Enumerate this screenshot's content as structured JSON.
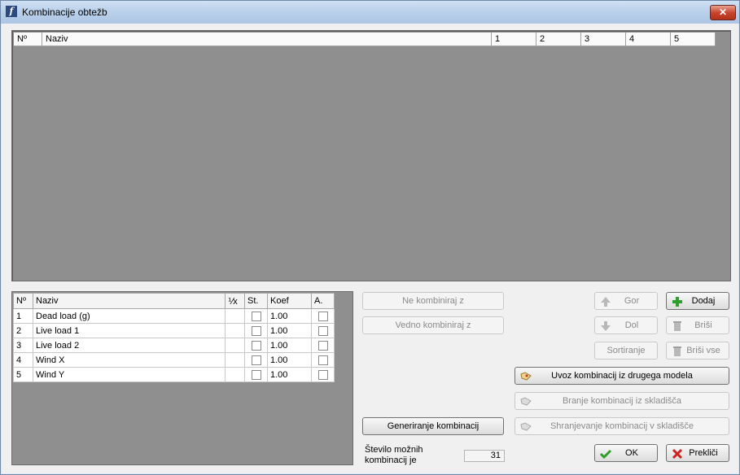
{
  "window": {
    "title": "Kombinacije obtežb"
  },
  "combinations_grid": {
    "columns": [
      "Nº",
      "Naziv",
      "1",
      "2",
      "3",
      "4",
      "5"
    ]
  },
  "loads_table": {
    "headers": [
      "Nº",
      "Naziv",
      "⅟x",
      "St.",
      "Koef",
      "A."
    ],
    "rows": [
      {
        "no": "1",
        "name": "Dead load (g)",
        "koef": "1.00"
      },
      {
        "no": "2",
        "name": "Live load 1",
        "koef": "1.00"
      },
      {
        "no": "3",
        "name": "Live load 2",
        "koef": "1.00"
      },
      {
        "no": "4",
        "name": "Wind X",
        "koef": "1.00"
      },
      {
        "no": "5",
        "name": "Wind Y",
        "koef": "1.00"
      }
    ]
  },
  "buttons": {
    "ne_kombiniraj": "Ne kombiniraj z",
    "vedno_kombiniraj": "Vedno kombiniraj z",
    "gor": "Gor",
    "dol": "Dol",
    "sortiranje": "Sortiranje",
    "dodaj": "Dodaj",
    "brisi": "Briši",
    "brisi_vse": "Briši vse",
    "uvoz": "Uvoz kombinacij iz drugega modela",
    "branje": "Branje kombinacij iz skladišča",
    "shranjevanje": "Shranjevanje kombinacij v skladišče",
    "generiranje": "Generiranje kombinacij",
    "ok": "OK",
    "preklici": "Prekliči"
  },
  "info": {
    "label_line1": "Število možnih",
    "label_line2": "kombinacij je",
    "count": "31"
  },
  "icons": {
    "app": "calculator-app-icon",
    "close": "close-icon",
    "up": "arrow-up-icon",
    "down": "arrow-down-icon",
    "add": "plus-icon",
    "delete": "trash-icon",
    "import": "tag-import-icon",
    "ok": "checkmark-icon",
    "cancel": "x-icon"
  },
  "colors": {
    "grid_bg": "#8f8f8f",
    "add_green": "#2e9e2e",
    "ok_green": "#2e9e2e",
    "cancel_red": "#cc2222"
  }
}
